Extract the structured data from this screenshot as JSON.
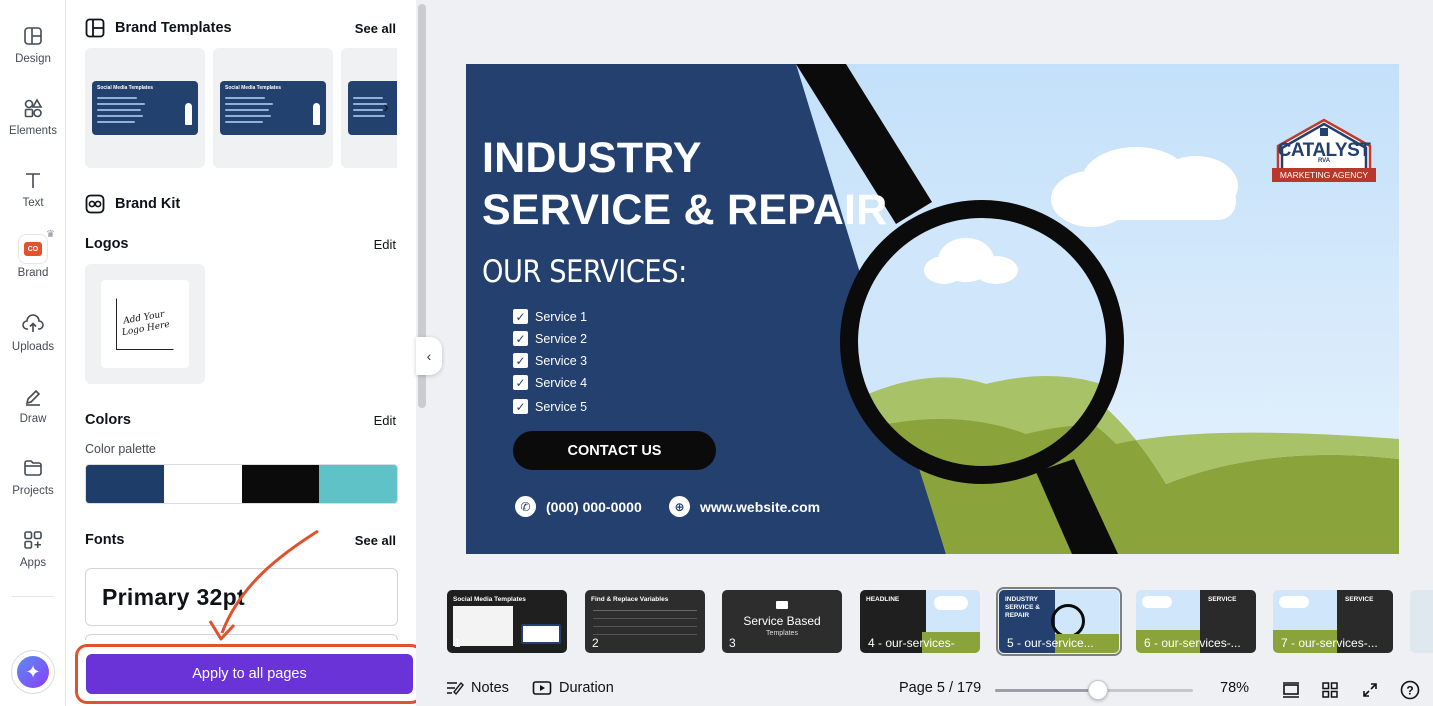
{
  "rail": {
    "items": [
      {
        "label": "Design",
        "icon": "design-icon"
      },
      {
        "label": "Elements",
        "icon": "elements-icon"
      },
      {
        "label": "Text",
        "icon": "text-icon"
      },
      {
        "label": "Brand",
        "icon": "brand-icon",
        "badge": "CO"
      },
      {
        "label": "Uploads",
        "icon": "uploads-icon"
      },
      {
        "label": "Draw",
        "icon": "draw-icon"
      },
      {
        "label": "Projects",
        "icon": "projects-icon"
      },
      {
        "label": "Apps",
        "icon": "apps-icon"
      }
    ]
  },
  "panel": {
    "brand_templates": {
      "title": "Brand Templates",
      "see_all": "See all",
      "card_title": "Social Media Templates"
    },
    "brand_kit": {
      "title": "Brand Kit"
    },
    "logos": {
      "title": "Logos",
      "edit": "Edit",
      "placeholder_text": "Add Your Logo Here"
    },
    "colors": {
      "title": "Colors",
      "edit": "Edit",
      "palette_label": "Color palette",
      "swatches": [
        "#1f3d69",
        "#ffffff",
        "#0b0b0b",
        "#5fc2c6"
      ]
    },
    "fonts": {
      "title": "Fonts",
      "see_all": "See all",
      "primary": "Primary 32pt"
    },
    "apply_button": "Apply to all pages"
  },
  "canvas": {
    "headline_1": "INDUSTRY",
    "headline_2": "SERVICE & REPAIR",
    "services_title": "OUR SERVICES:",
    "services": [
      "Service 1",
      "Service 2",
      "Service 3",
      "Service 4",
      "Service 5"
    ],
    "contact_button": "CONTACT US",
    "phone": "(000) 000-0000",
    "website": "www.website.com",
    "logo": {
      "name": "CATALYST",
      "sub": "RVA",
      "ribbon": "MARKETING AGENCY"
    },
    "colors": {
      "navy": "#23406e",
      "sky": "#cfe6fb",
      "grass": "#8aa33a"
    }
  },
  "thumbnails": [
    {
      "label": "1",
      "title": "Social Media Templates"
    },
    {
      "label": "2",
      "title": "Find & Replace Variables"
    },
    {
      "label": "3",
      "title": "Service Based",
      "subtitle": "Templates"
    },
    {
      "label": "4 - our-services-",
      "title": "HEADLINE"
    },
    {
      "label": "5 - our-service...",
      "title": "INDUSTRY SERVICE & REPAIR",
      "selected": true
    },
    {
      "label": "6 - our-services-...",
      "title": "SERVICE"
    },
    {
      "label": "7 - our-services-...",
      "title": "SERVICE"
    }
  ],
  "footer": {
    "notes": "Notes",
    "duration": "Duration",
    "page": "Page 5 / 179",
    "zoom": "78%",
    "zoom_fraction": 0.52
  }
}
